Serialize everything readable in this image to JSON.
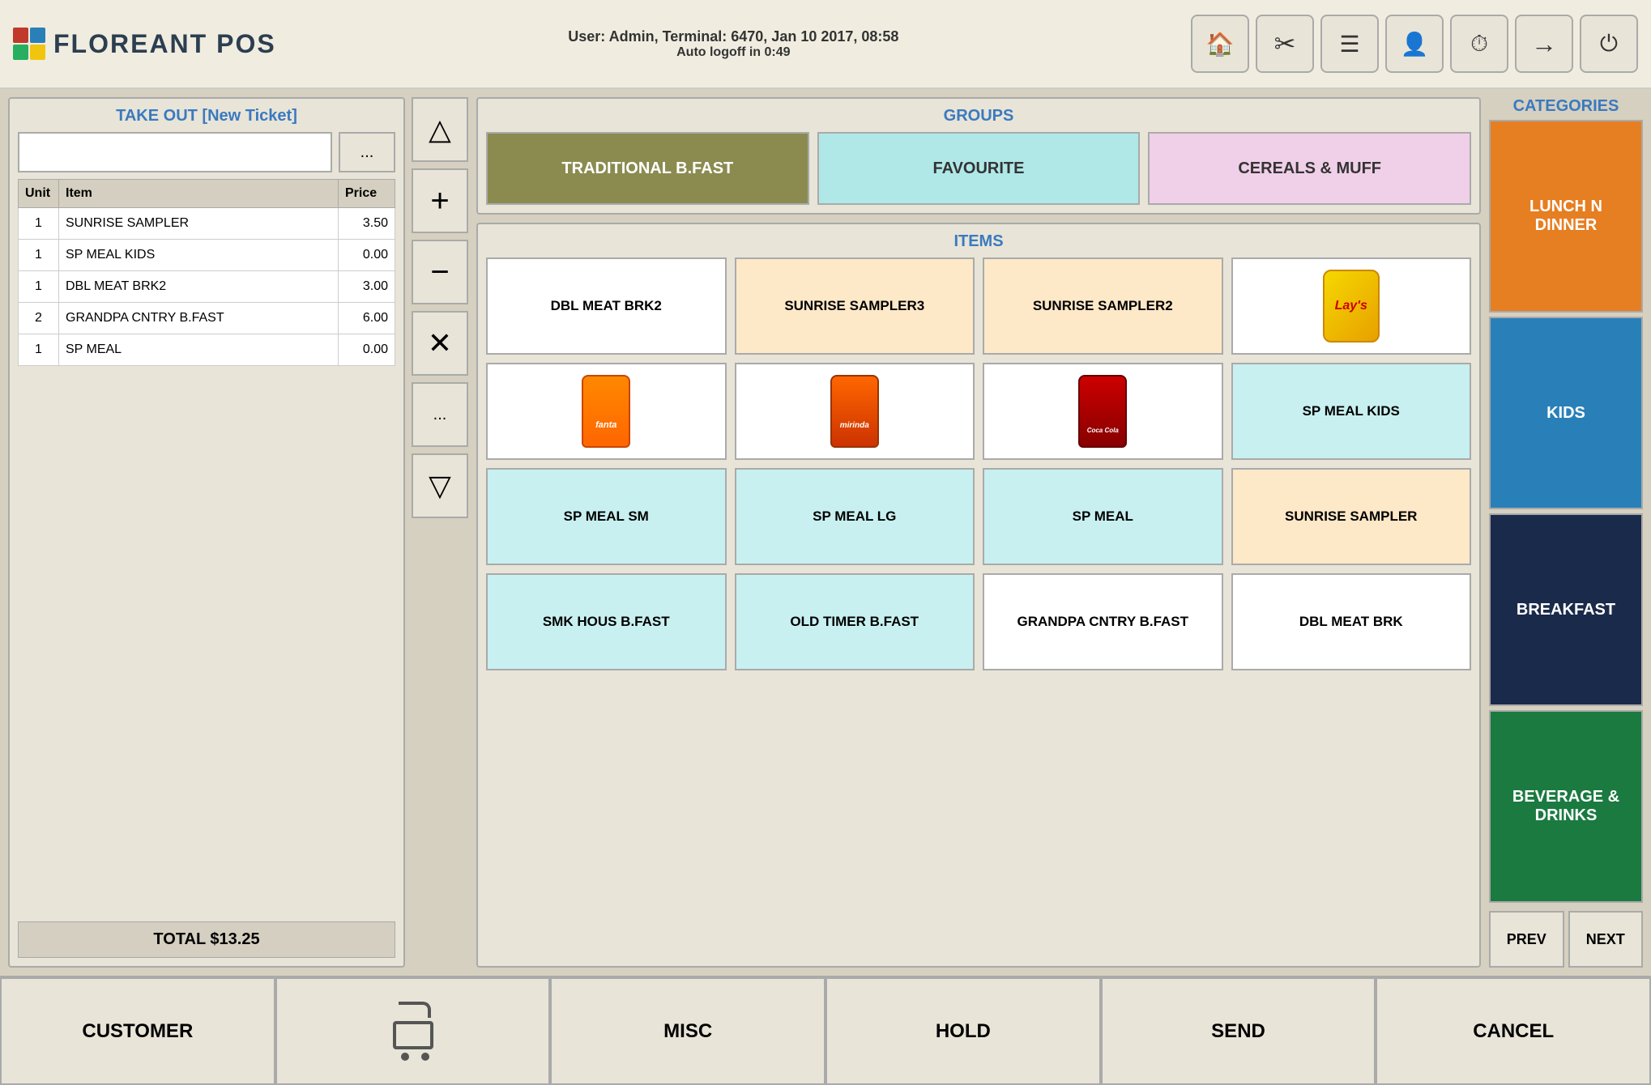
{
  "header": {
    "logo_text": "FLOREANT POS",
    "user_info": "User: Admin, Terminal: 6470, Jan 10 2017, 08:58",
    "auto_logoff": "Auto logoff in 0:49",
    "icons": [
      {
        "name": "home-icon",
        "symbol": "🏠"
      },
      {
        "name": "tools-icon",
        "symbol": "✂"
      },
      {
        "name": "list-icon",
        "symbol": "☰"
      },
      {
        "name": "user-settings-icon",
        "symbol": "👤"
      },
      {
        "name": "timer-icon",
        "symbol": "⏱"
      },
      {
        "name": "forward-icon",
        "symbol": "→"
      },
      {
        "name": "power-icon",
        "symbol": "⏻"
      }
    ]
  },
  "ticket": {
    "title": "TAKE OUT [New Ticket]",
    "input_placeholder": "",
    "ellipsis_label": "...",
    "columns": [
      "Unit",
      "Item",
      "Price"
    ],
    "rows": [
      {
        "unit": "1",
        "item": "SUNRISE SAMPLER",
        "price": "3.50"
      },
      {
        "unit": "1",
        "item": "SP MEAL KIDS",
        "price": "0.00"
      },
      {
        "unit": "1",
        "item": "DBL MEAT BRK2",
        "price": "3.00"
      },
      {
        "unit": "2",
        "item": "GRANDPA CNTRY B.FAST",
        "price": "6.00"
      },
      {
        "unit": "1",
        "item": "SP MEAL",
        "price": "0.00"
      }
    ],
    "total": "TOTAL $13.25"
  },
  "controls": {
    "up_arrow": "△",
    "plus": "+",
    "minus": "−",
    "close": "✕",
    "ellipsis": "...",
    "down_arrow": "▽"
  },
  "groups": {
    "title": "GROUPS",
    "buttons": [
      {
        "label": "TRADITIONAL B.FAST",
        "style": "selected"
      },
      {
        "label": "FAVOURITE",
        "style": "light-cyan"
      },
      {
        "label": "CEREALS & MUFF",
        "style": "light-pink"
      }
    ]
  },
  "items": {
    "title": "ITEMS",
    "buttons": [
      {
        "label": "DBL MEAT BRK2",
        "style": "plain-white"
      },
      {
        "label": "SUNRISE SAMPLER3",
        "style": "peach"
      },
      {
        "label": "SUNRISE SAMPLER2",
        "style": "peach"
      },
      {
        "label": "LAYS",
        "style": "img-lays"
      },
      {
        "label": "FANTA",
        "style": "img-fanta"
      },
      {
        "label": "MIRINDA",
        "style": "img-mirinda"
      },
      {
        "label": "COCA COLA",
        "style": "img-cocacola"
      },
      {
        "label": "SP MEAL KIDS",
        "style": "light-cyan"
      },
      {
        "label": "SP MEAL SM",
        "style": "light-cyan"
      },
      {
        "label": "SP MEAL LG",
        "style": "light-cyan"
      },
      {
        "label": "SP MEAL",
        "style": "light-cyan"
      },
      {
        "label": "SUNRISE SAMPLER",
        "style": "peach"
      },
      {
        "label": "SMK HOUS B.FAST",
        "style": "light-cyan"
      },
      {
        "label": "OLD TIMER B.FAST",
        "style": "light-cyan"
      },
      {
        "label": "GRANDPA CNTRY B.FAST",
        "style": "plain-white"
      },
      {
        "label": "DBL MEAT BRK",
        "style": "plain-white"
      }
    ]
  },
  "categories": {
    "title": "CATEGORIES",
    "buttons": [
      {
        "label": "LUNCH N DINNER",
        "style": "cat-orange"
      },
      {
        "label": "KIDS",
        "style": "cat-blue"
      },
      {
        "label": "BREAKFAST",
        "style": "cat-dark-navy"
      },
      {
        "label": "BEVERAGE & DRINKS",
        "style": "cat-green"
      }
    ],
    "prev_label": "PREV",
    "next_label": "NEXT"
  },
  "bottom": {
    "customer_label": "CUSTOMER",
    "misc_label": "MISC",
    "hold_label": "HOLD",
    "send_label": "SEND",
    "cancel_label": "CANCEL"
  }
}
